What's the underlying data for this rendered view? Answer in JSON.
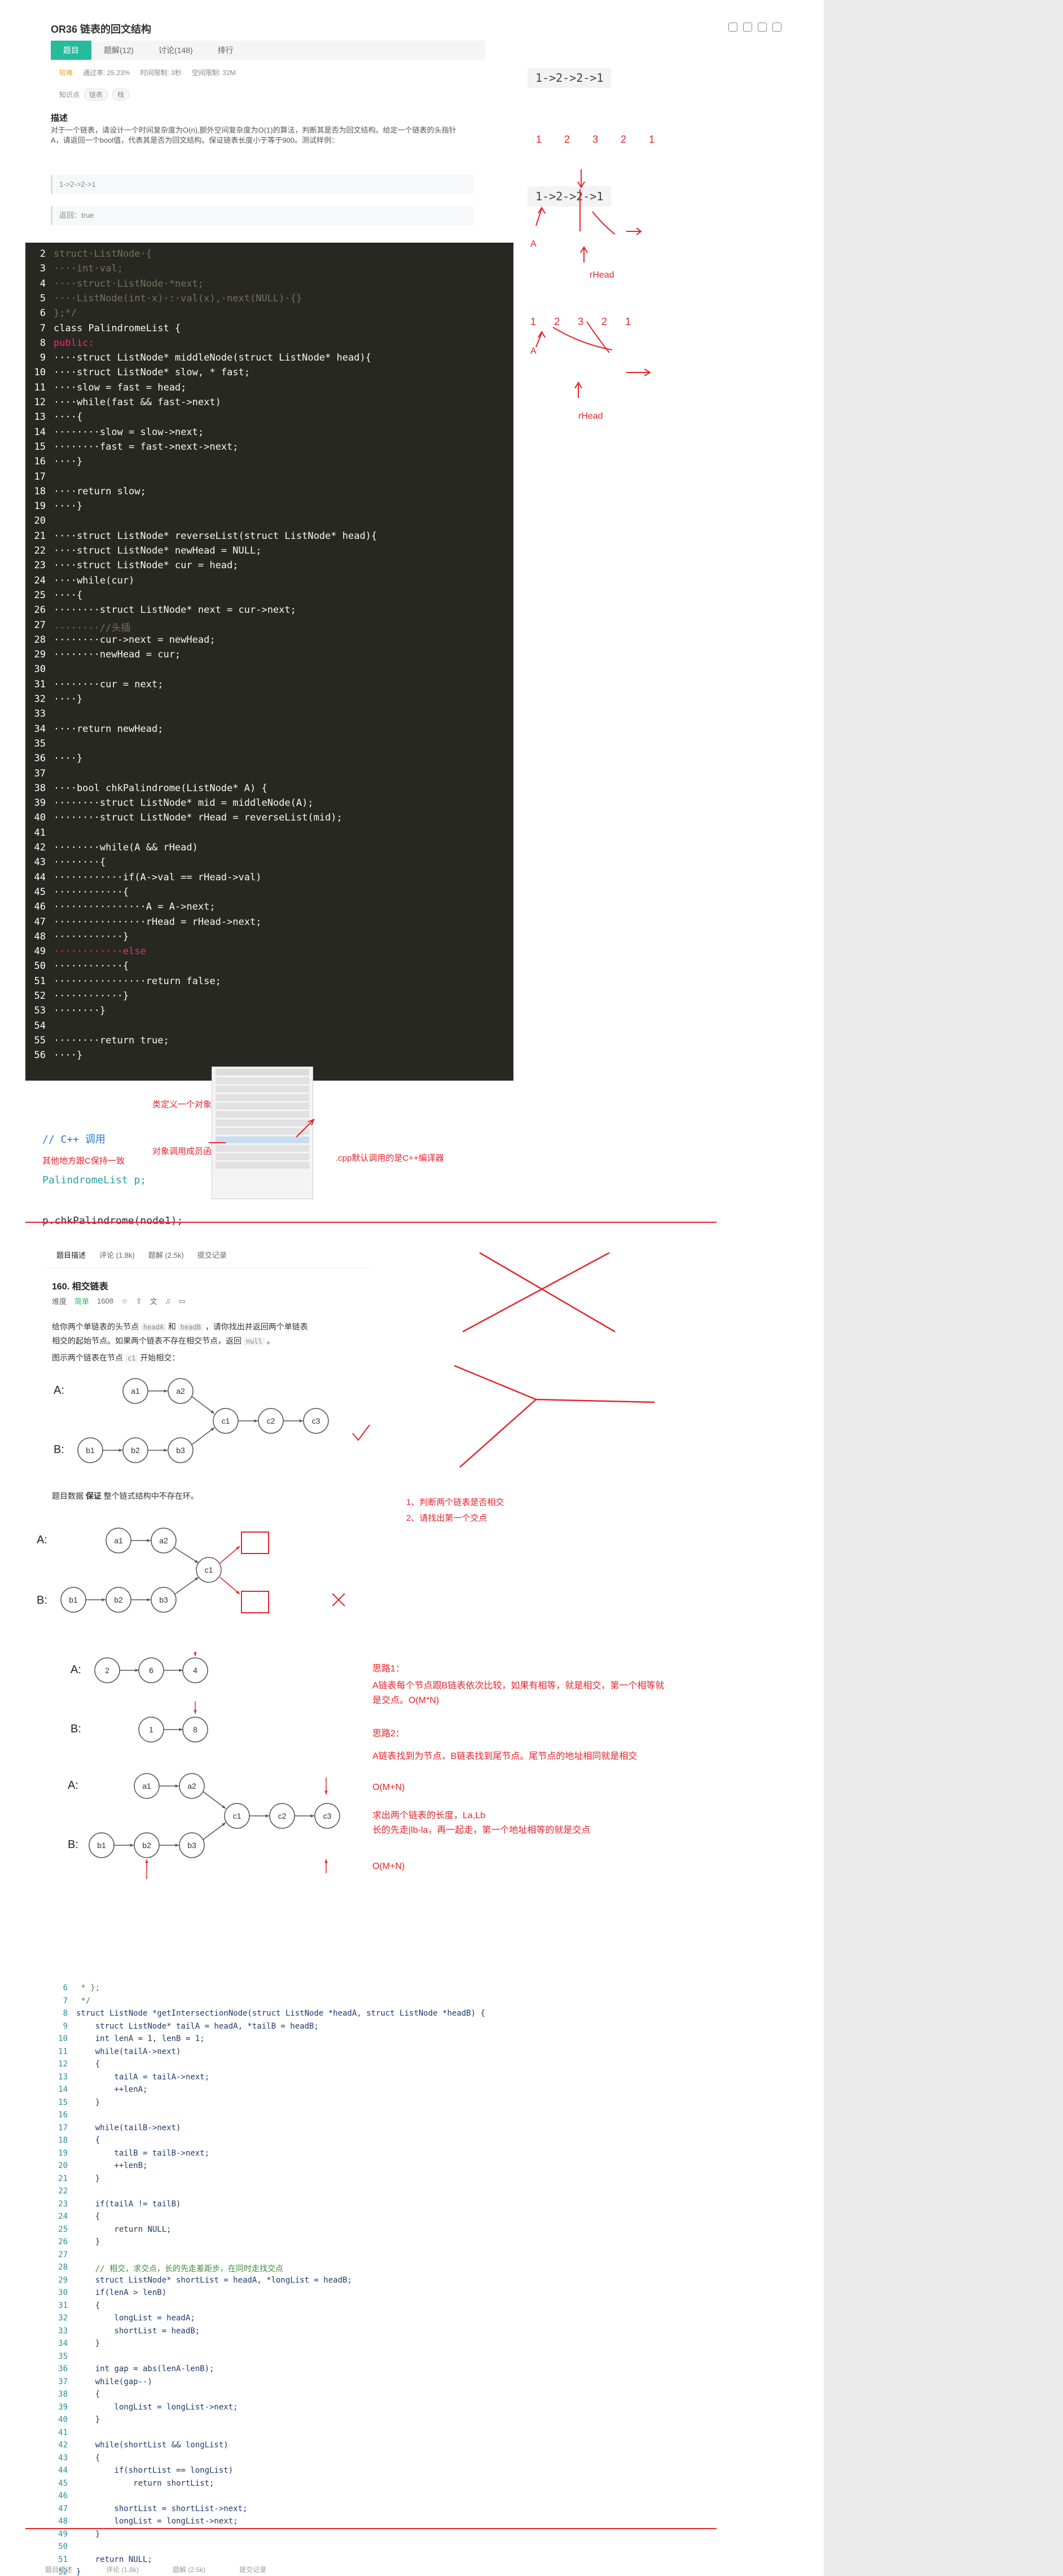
{
  "problem1": {
    "title": "OR36 链表的回文结构",
    "tabs": [
      "题目",
      "题解(12)",
      "讨论(148)",
      "排行"
    ],
    "meta": {
      "difficulty": "较难",
      "pass_rate": "通过率: 25.23%",
      "time_limit": "时间限制: 3秒",
      "space_limit": "空间限制: 32M"
    },
    "knowledge_label": "知识点",
    "knowledge_tags": [
      "链表",
      "栈"
    ],
    "desc_heading": "描述",
    "desc_text": "对于一个链表，请设计一个时间复杂度为O(n),额外空间复杂度为O(1)的算法，判断其是否为回文结构。给定一个链表的头指针A，请返回一个bool值，代表其是否为回文结构。保证链表长度小于等于900。测试样例：",
    "sample_input": "1->2->2->1",
    "sample_output": "返回：true"
  },
  "code1": [
    {
      "n": "2",
      "t": "struct·ListNode·{",
      "c": "cm"
    },
    {
      "n": "3",
      "t": "····int·val;",
      "c": "cm"
    },
    {
      "n": "4",
      "t": "····struct·ListNode·*next;",
      "c": "cm"
    },
    {
      "n": "5",
      "t": "····ListNode(int·x)·:·val(x),·next(NULL)·{}",
      "c": "cm"
    },
    {
      "n": "6",
      "t": "};*/",
      "c": "cm"
    },
    {
      "n": "7",
      "t": "class PalindromeList {",
      "c": "a"
    },
    {
      "n": "8",
      "t": "public:",
      "c": "kw"
    },
    {
      "n": "9",
      "t": "····struct ListNode* middleNode(struct ListNode* head){",
      "c": "a"
    },
    {
      "n": "10",
      "t": "····struct ListNode* slow, * fast;",
      "c": "a"
    },
    {
      "n": "11",
      "t": "····slow = fast = head;",
      "c": ""
    },
    {
      "n": "12",
      "t": "····while(fast && fast->next)",
      "c": "a"
    },
    {
      "n": "13",
      "t": "····{",
      "c": ""
    },
    {
      "n": "14",
      "t": "········slow = slow->next;",
      "c": ""
    },
    {
      "n": "15",
      "t": "········fast = fast->next->next;",
      "c": ""
    },
    {
      "n": "16",
      "t": "····}",
      "c": ""
    },
    {
      "n": "17",
      "t": "",
      "c": ""
    },
    {
      "n": "18",
      "t": "····return slow;",
      "c": "a"
    },
    {
      "n": "19",
      "t": "····}",
      "c": ""
    },
    {
      "n": "20",
      "t": "",
      "c": ""
    },
    {
      "n": "21",
      "t": "····struct ListNode* reverseList(struct ListNode* head){",
      "c": "a"
    },
    {
      "n": "22",
      "t": "····struct ListNode* newHead = NULL;",
      "c": "a"
    },
    {
      "n": "23",
      "t": "····struct ListNode* cur = head;",
      "c": "a"
    },
    {
      "n": "24",
      "t": "····while(cur)",
      "c": "a"
    },
    {
      "n": "25",
      "t": "····{",
      "c": ""
    },
    {
      "n": "26",
      "t": "········struct ListNode* next = cur->next;",
      "c": "a"
    },
    {
      "n": "27",
      "t": "········//头插",
      "c": "cm"
    },
    {
      "n": "28",
      "t": "········cur->next = newHead;",
      "c": ""
    },
    {
      "n": "29",
      "t": "········newHead = cur;",
      "c": ""
    },
    {
      "n": "30",
      "t": "",
      "c": ""
    },
    {
      "n": "31",
      "t": "········cur = next;",
      "c": ""
    },
    {
      "n": "32",
      "t": "····}",
      "c": ""
    },
    {
      "n": "33",
      "t": "",
      "c": ""
    },
    {
      "n": "34",
      "t": "····return newHead;",
      "c": "a"
    },
    {
      "n": "35",
      "t": "",
      "c": ""
    },
    {
      "n": "36",
      "t": "····}",
      "c": ""
    },
    {
      "n": "37",
      "t": "",
      "c": ""
    },
    {
      "n": "38",
      "t": "····bool chkPalindrome(ListNode* A) {",
      "c": "a"
    },
    {
      "n": "39",
      "t": "········struct ListNode* mid = middleNode(A);",
      "c": "a"
    },
    {
      "n": "40",
      "t": "········struct ListNode* rHead = reverseList(mid);",
      "c": "a"
    },
    {
      "n": "41",
      "t": "",
      "c": ""
    },
    {
      "n": "42",
      "t": "········while(A && rHead)",
      "c": "a"
    },
    {
      "n": "43",
      "t": "········{",
      "c": ""
    },
    {
      "n": "44",
      "t": "············if(A->val == rHead->val)",
      "c": "a"
    },
    {
      "n": "45",
      "t": "············{",
      "c": ""
    },
    {
      "n": "46",
      "t": "················A = A->next;",
      "c": ""
    },
    {
      "n": "47",
      "t": "················rHead = rHead->next;",
      "c": ""
    },
    {
      "n": "48",
      "t": "············}",
      "c": ""
    },
    {
      "n": "49",
      "t": "············else",
      "c": "kw"
    },
    {
      "n": "50",
      "t": "············{",
      "c": ""
    },
    {
      "n": "51",
      "t": "················return false;",
      "c": "a"
    },
    {
      "n": "52",
      "t": "············}",
      "c": ""
    },
    {
      "n": "53",
      "t": "········}",
      "c": ""
    },
    {
      "n": "54",
      "t": "",
      "c": ""
    },
    {
      "n": "55",
      "t": "········return true;",
      "c": "a"
    },
    {
      "n": "56",
      "t": "····}",
      "c": ""
    }
  ],
  "call_snippet": {
    "comment": "// C++ 调用",
    "line1": "PalindromeList p;",
    "line2": "p.chkPalindrome(node1);"
  },
  "call_notes": {
    "n1": "类定义一个对象",
    "n2": "对象调用成员函数",
    "n3": "其他地方跟C保持一致",
    "n4": ".cpp默认调用的是C++编译器"
  },
  "right_notes1": {
    "seq": "1->2->2->1",
    "nums": [
      "1",
      "2",
      "3",
      "2",
      "1"
    ],
    "seq2": "1->2->2->1",
    "A": "A",
    "rHead": "rHead",
    "nums2": [
      "1",
      "2",
      "3",
      "2",
      "1"
    ],
    "A2": "A",
    "rHead2": "rHead"
  },
  "problem2": {
    "tabs": [
      "题目描述",
      "评论 (1.8k)",
      "题解 (2.5k)",
      "提交记录"
    ],
    "title": "160. 相交链表",
    "difficulty_label": "难度",
    "difficulty": "简单",
    "likes": "1608",
    "text1a": "给你两个单链表的头节点",
    "code_a": "headA",
    "text1b": "和",
    "code_b": "headB",
    "text1c": "，请你找出并返回两个单链表",
    "text2a": "相交的起始节点。如果两个链表不存在相交节点，返回",
    "code_null": "null",
    "text2b": "。",
    "text3a": "图示两个链表在节点",
    "code_c1": "c1",
    "text3b": "开始相交：",
    "text4a": "题目数据",
    "text4b": "保证",
    "text4c": "整个链式结构中不存在环。"
  },
  "diagram_nodes": {
    "a": [
      "a1",
      "a2"
    ],
    "b": [
      "b1",
      "b2",
      "b3"
    ],
    "c": [
      "c1",
      "c2",
      "c3"
    ],
    "labelA": "A:",
    "labelB": "B:",
    "small_a": [
      "2",
      "6",
      "4"
    ],
    "small_b": [
      "1",
      "8"
    ]
  },
  "notes2": {
    "q1": "1、判断两个链表是否相交",
    "q2": "2、请找出第一个交点",
    "idea1_title": "思路1：",
    "idea1_body": "A链表每个节点跟B链表依次比较，如果有相等，就是相交，第一个相等就\n是交点。O(M*N)",
    "idea2_title": "思路2：",
    "idea2_body": "A链表找到为节点，B链表找到尾节点。尾节点的地址相同就是相交",
    "o1": "O(M+N)",
    "idea3": "求出两个链表的长度，La,Lb\n长的先走|lb-la，再一起走，第一个地址相等的就是交点",
    "o2": "O(M+N)"
  },
  "code2": [
    {
      "n": "6",
      "t": " * };",
      "c": "cm"
    },
    {
      "n": "7",
      "t": " */",
      "c": "cm"
    },
    {
      "n": "8",
      "t": "struct ListNode *getIntersectionNode(struct ListNode *headA, struct ListNode *headB) {",
      "c": ""
    },
    {
      "n": "9",
      "t": "    struct ListNode* tailA = headA, *tailB = headB;",
      "c": ""
    },
    {
      "n": "10",
      "t": "    int lenA = 1, lenB = 1;",
      "c": ""
    },
    {
      "n": "11",
      "t": "    while(tailA->next)",
      "c": ""
    },
    {
      "n": "12",
      "t": "    {",
      "c": ""
    },
    {
      "n": "13",
      "t": "        tailA = tailA->next;",
      "c": ""
    },
    {
      "n": "14",
      "t": "        ++lenA;",
      "c": ""
    },
    {
      "n": "15",
      "t": "    }",
      "c": ""
    },
    {
      "n": "16",
      "t": "",
      "c": ""
    },
    {
      "n": "17",
      "t": "    while(tailB->next)",
      "c": ""
    },
    {
      "n": "18",
      "t": "    {",
      "c": ""
    },
    {
      "n": "19",
      "t": "        tailB = tailB->next;",
      "c": ""
    },
    {
      "n": "20",
      "t": "        ++lenB;",
      "c": ""
    },
    {
      "n": "21",
      "t": "    }",
      "c": ""
    },
    {
      "n": "22",
      "t": "",
      "c": ""
    },
    {
      "n": "23",
      "t": "    if(tailA != tailB)",
      "c": ""
    },
    {
      "n": "24",
      "t": "    {",
      "c": ""
    },
    {
      "n": "25",
      "t": "        return NULL;",
      "c": ""
    },
    {
      "n": "26",
      "t": "    }",
      "c": ""
    },
    {
      "n": "27",
      "t": "",
      "c": ""
    },
    {
      "n": "28",
      "t": "    // 相交，求交点，长的先走差距步，在同时走找交点",
      "c": "cm"
    },
    {
      "n": "29",
      "t": "    struct ListNode* shortList = headA, *longList = headB;",
      "c": ""
    },
    {
      "n": "30",
      "t": "    if(lenA > lenB)",
      "c": ""
    },
    {
      "n": "31",
      "t": "    {",
      "c": ""
    },
    {
      "n": "32",
      "t": "        longList = headA;",
      "c": ""
    },
    {
      "n": "33",
      "t": "        shortList = headB;",
      "c": ""
    },
    {
      "n": "34",
      "t": "    }",
      "c": ""
    },
    {
      "n": "35",
      "t": "",
      "c": ""
    },
    {
      "n": "36",
      "t": "    int gap = abs(lenA-lenB);",
      "c": ""
    },
    {
      "n": "37",
      "t": "    while(gap--)",
      "c": ""
    },
    {
      "n": "38",
      "t": "    {",
      "c": ""
    },
    {
      "n": "39",
      "t": "        longList = longList->next;",
      "c": ""
    },
    {
      "n": "40",
      "t": "    }",
      "c": ""
    },
    {
      "n": "41",
      "t": "",
      "c": ""
    },
    {
      "n": "42",
      "t": "    while(shortList && longList)",
      "c": ""
    },
    {
      "n": "43",
      "t": "    {",
      "c": ""
    },
    {
      "n": "44",
      "t": "        if(shortList == longList)",
      "c": ""
    },
    {
      "n": "45",
      "t": "            return shortList;",
      "c": ""
    },
    {
      "n": "46",
      "t": "",
      "c": ""
    },
    {
      "n": "47",
      "t": "        shortList = shortList->next;",
      "c": ""
    },
    {
      "n": "48",
      "t": "        longList = longList->next;",
      "c": ""
    },
    {
      "n": "49",
      "t": "    }",
      "c": ""
    },
    {
      "n": "50",
      "t": "",
      "c": ""
    },
    {
      "n": "51",
      "t": "    return NULL;",
      "c": ""
    },
    {
      "n": "52",
      "t": "}",
      "c": ""
    },
    {
      "n": "53",
      "t": "",
      "c": ""
    }
  ],
  "colors": {
    "accent": "#25bb9b",
    "annotation": "#e8232b",
    "code_bg": "#272822"
  }
}
